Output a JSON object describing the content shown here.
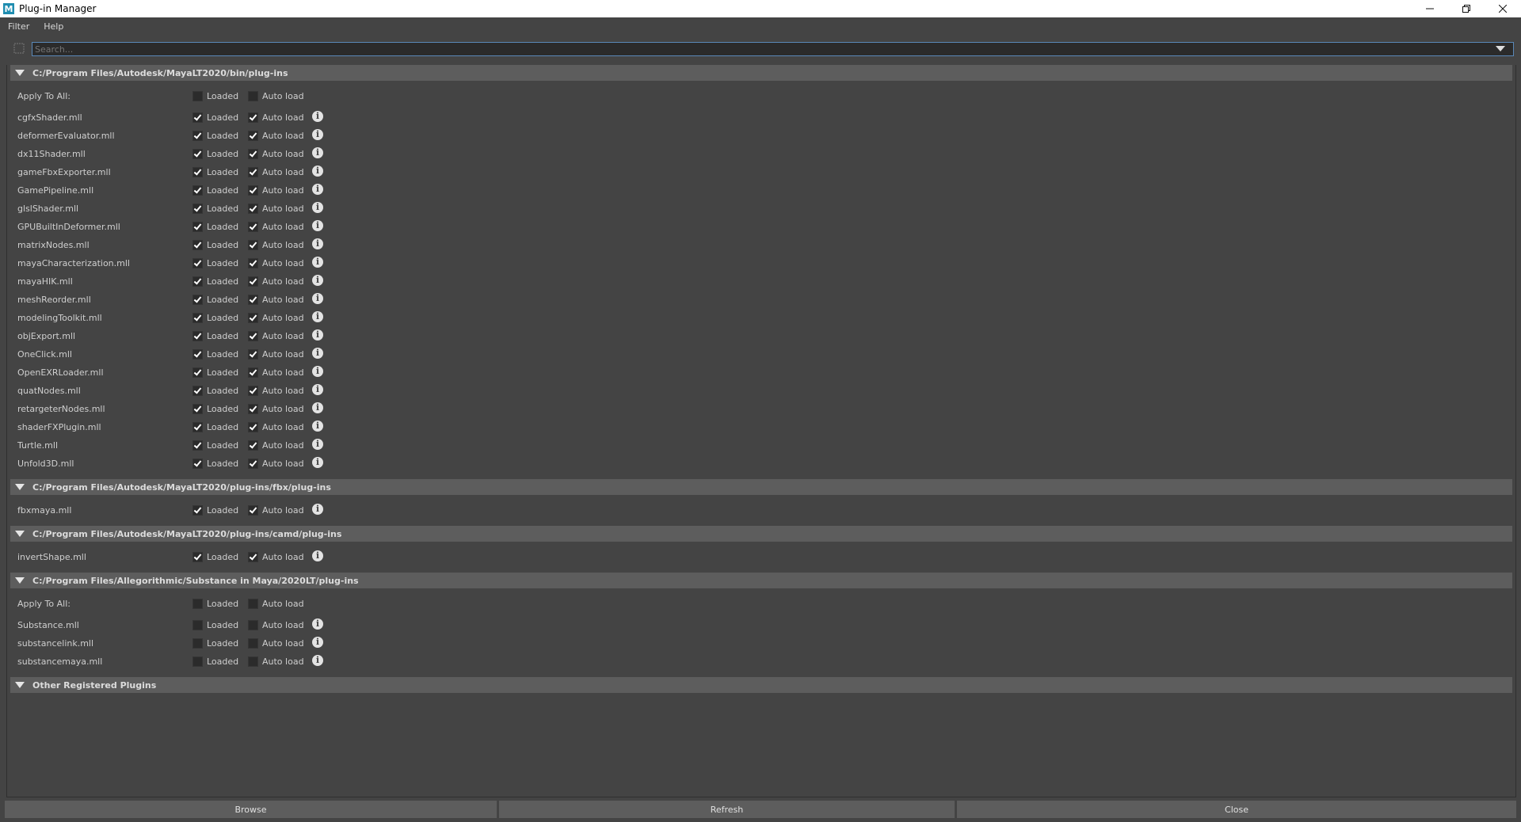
{
  "window": {
    "title": "Plug-in Manager"
  },
  "menu": [
    "Filter",
    "Help"
  ],
  "search": {
    "placeholder": "Search..."
  },
  "labels": {
    "loaded": "Loaded",
    "autoload": "Auto load",
    "apply_all": "Apply To All:"
  },
  "sections": [
    {
      "path": "C:/Program Files/Autodesk/MayaLT2020/bin/plug-ins",
      "apply_all": true,
      "apply_loaded": false,
      "apply_autoload": false,
      "plugins": [
        {
          "name": "cgfxShader.mll",
          "loaded": true,
          "autoload": true
        },
        {
          "name": "deformerEvaluator.mll",
          "loaded": true,
          "autoload": true
        },
        {
          "name": "dx11Shader.mll",
          "loaded": true,
          "autoload": true
        },
        {
          "name": "gameFbxExporter.mll",
          "loaded": true,
          "autoload": true
        },
        {
          "name": "GamePipeline.mll",
          "loaded": true,
          "autoload": true
        },
        {
          "name": "glslShader.mll",
          "loaded": true,
          "autoload": true
        },
        {
          "name": "GPUBuiltInDeformer.mll",
          "loaded": true,
          "autoload": true
        },
        {
          "name": "matrixNodes.mll",
          "loaded": true,
          "autoload": true
        },
        {
          "name": "mayaCharacterization.mll",
          "loaded": true,
          "autoload": true
        },
        {
          "name": "mayaHIK.mll",
          "loaded": true,
          "autoload": true
        },
        {
          "name": "meshReorder.mll",
          "loaded": true,
          "autoload": true
        },
        {
          "name": "modelingToolkit.mll",
          "loaded": true,
          "autoload": true
        },
        {
          "name": "objExport.mll",
          "loaded": true,
          "autoload": true
        },
        {
          "name": "OneClick.mll",
          "loaded": true,
          "autoload": true
        },
        {
          "name": "OpenEXRLoader.mll",
          "loaded": true,
          "autoload": true
        },
        {
          "name": "quatNodes.mll",
          "loaded": true,
          "autoload": true
        },
        {
          "name": "retargeterNodes.mll",
          "loaded": true,
          "autoload": true
        },
        {
          "name": "shaderFXPlugin.mll",
          "loaded": true,
          "autoload": true
        },
        {
          "name": "Turtle.mll",
          "loaded": true,
          "autoload": true
        },
        {
          "name": "Unfold3D.mll",
          "loaded": true,
          "autoload": true
        }
      ]
    },
    {
      "path": "C:/Program Files/Autodesk/MayaLT2020/plug-ins/fbx/plug-ins",
      "apply_all": false,
      "plugins": [
        {
          "name": "fbxmaya.mll",
          "loaded": true,
          "autoload": true
        }
      ]
    },
    {
      "path": "C:/Program Files/Autodesk/MayaLT2020/plug-ins/camd/plug-ins",
      "apply_all": false,
      "plugins": [
        {
          "name": "invertShape.mll",
          "loaded": true,
          "autoload": true
        }
      ]
    },
    {
      "path": "C:/Program Files/Allegorithmic/Substance in Maya/2020LT/plug-ins",
      "apply_all": true,
      "apply_loaded": false,
      "apply_autoload": false,
      "plugins": [
        {
          "name": "Substance.mll",
          "loaded": false,
          "autoload": false
        },
        {
          "name": "substancelink.mll",
          "loaded": false,
          "autoload": false
        },
        {
          "name": "substancemaya.mll",
          "loaded": false,
          "autoload": false
        }
      ]
    },
    {
      "path": "Other Registered Plugins",
      "apply_all": false,
      "plugins": []
    }
  ],
  "buttons": {
    "browse": "Browse",
    "refresh": "Refresh",
    "close": "Close"
  },
  "icons": {
    "app": "maya-icon",
    "minimize": "minimize-icon",
    "restore": "restore-icon",
    "close": "close-icon",
    "filter": "filter-icon",
    "info": "info-icon"
  }
}
